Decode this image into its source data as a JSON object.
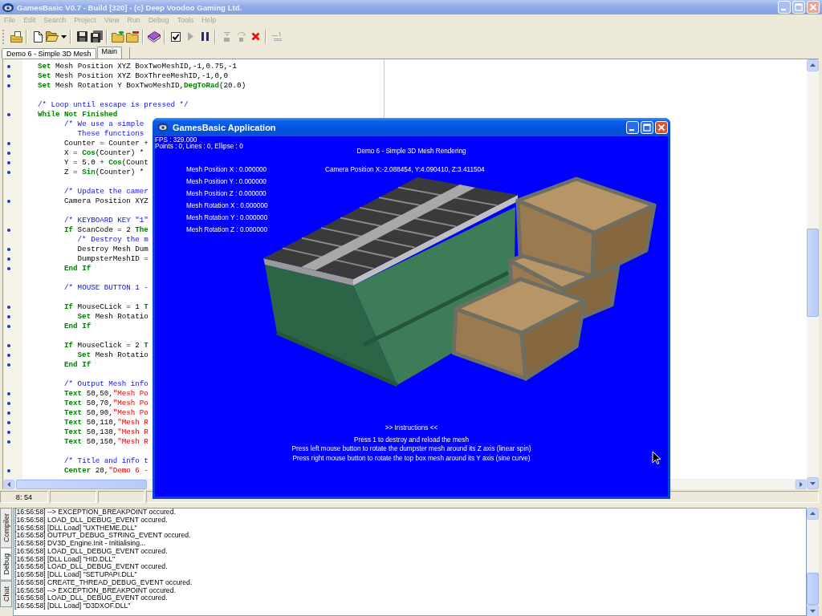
{
  "window": {
    "title": "GamesBasic V0.7 - Build [320] - (c) Deep Voodoo Gaming Ltd.",
    "active": false
  },
  "menu": [
    {
      "label": "File",
      "disabled": true
    },
    {
      "label": "Edit",
      "disabled": true
    },
    {
      "label": "Search",
      "disabled": true
    },
    {
      "label": "Project",
      "disabled": true
    },
    {
      "label": "View",
      "disabled": true
    },
    {
      "label": "Run",
      "disabled": true
    },
    {
      "label": "Debug",
      "disabled": true
    },
    {
      "label": "Tools",
      "disabled": true
    },
    {
      "label": "Help",
      "disabled": true
    }
  ],
  "toolbar": [
    {
      "buttons": [
        {
          "kind": "project",
          "disabled": false
        }
      ]
    },
    {
      "buttons": [
        {
          "kind": "newfile",
          "disabled": false
        },
        {
          "kind": "open",
          "disabled": false
        },
        {
          "kind": "dropdown",
          "disabled": false
        }
      ]
    },
    {
      "buttons": [
        {
          "kind": "save",
          "disabled": false
        },
        {
          "kind": "saveall",
          "disabled": false
        }
      ]
    },
    {
      "buttons": [
        {
          "kind": "addfile",
          "disabled": false
        },
        {
          "kind": "removefile",
          "disabled": false
        }
      ]
    },
    {
      "buttons": [
        {
          "kind": "help",
          "disabled": false
        }
      ]
    },
    {
      "buttons": [
        {
          "kind": "check",
          "disabled": false
        },
        {
          "kind": "run",
          "disabled": true
        },
        {
          "kind": "pause",
          "disabled": false
        }
      ]
    },
    {
      "buttons": [
        {
          "kind": "stepin",
          "disabled": true
        },
        {
          "kind": "stepover",
          "disabled": true
        },
        {
          "kind": "stop",
          "disabled": false
        }
      ]
    },
    {
      "buttons": [
        {
          "kind": "watch",
          "disabled": true
        }
      ]
    }
  ],
  "tabs": [
    {
      "label": "Demo 6 - Simple 3D Mesh",
      "selected": false
    },
    {
      "label": "Main",
      "selected": true
    }
  ],
  "editor": {
    "lines": [
      {
        "marker": true,
        "segments": [
          {
            "kind": "keyword",
            "text": "Set"
          },
          {
            "kind": "plain",
            "text": " Mesh Position XYZ BoxTwoMeshID,-1,0.75,-1"
          }
        ]
      },
      {
        "marker": true,
        "segments": [
          {
            "kind": "keyword",
            "text": "Set"
          },
          {
            "kind": "plain",
            "text": " Mesh Position XYZ BoxThreeMeshID,-1,0,0"
          }
        ]
      },
      {
        "marker": true,
        "segments": [
          {
            "kind": "keyword",
            "text": "Set"
          },
          {
            "kind": "plain",
            "text": " Mesh Rotation Y BoxTwoMeshID,"
          },
          {
            "kind": "keyword",
            "text": "DegToRad"
          },
          {
            "kind": "plain",
            "text": "(20.0)"
          }
        ]
      },
      {
        "marker": false
      },
      {
        "marker": false,
        "segments": [
          {
            "kind": "comment",
            "text": "/* Loop until escape is pressed */"
          }
        ]
      },
      {
        "marker": true,
        "segments": [
          {
            "kind": "keyword",
            "text": "While Not Finished"
          }
        ],
        "children": [
          {
            "marker": false,
            "segments": [
              {
                "kind": "comment",
                "text": "/* We use a simple"
              }
            ],
            "children": [
              {
                "marker": false,
                "segments": [
                  {
                    "kind": "comment",
                    "text": "These functions"
                  }
                ]
              }
            ]
          },
          {
            "marker": true,
            "segments": [
              {
                "kind": "plain",
                "text": "Counter = Counter +"
              }
            ]
          },
          {
            "marker": true,
            "segments": [
              {
                "kind": "plain",
                "text": "X = "
              },
              {
                "kind": "keyword",
                "text": "Cos"
              },
              {
                "kind": "plain",
                "text": "(Counter) *"
              }
            ]
          },
          {
            "marker": true,
            "segments": [
              {
                "kind": "plain",
                "text": "Y = 5.0 + "
              },
              {
                "kind": "keyword",
                "text": "Cos"
              },
              {
                "kind": "plain",
                "text": "(Count"
              }
            ]
          },
          {
            "marker": true,
            "segments": [
              {
                "kind": "plain",
                "text": "Z = "
              },
              {
                "kind": "keyword",
                "text": "Sin"
              },
              {
                "kind": "plain",
                "text": "(Counter) *"
              }
            ]
          },
          {
            "marker": false
          },
          {
            "marker": false,
            "segments": [
              {
                "kind": "comment",
                "text": "/* Update the camer"
              }
            ]
          },
          {
            "marker": true,
            "segments": [
              {
                "kind": "plain",
                "text": "Camera Position XYZ"
              }
            ]
          },
          {
            "marker": false
          },
          {
            "marker": false,
            "segments": [
              {
                "kind": "comment",
                "text": "/* KEYBOARD KEY \"1\""
              }
            ]
          },
          {
            "marker": true,
            "segments": [
              {
                "kind": "keyword",
                "text": "If"
              },
              {
                "kind": "plain",
                "text": " ScanCode = 2 "
              },
              {
                "kind": "keyword",
                "text": "The"
              }
            ],
            "children": [
              {
                "marker": false,
                "segments": [
                  {
                    "kind": "comment",
                    "text": "/* Destroy the m"
                  }
                ]
              },
              {
                "marker": true,
                "segments": [
                  {
                    "kind": "plain",
                    "text": "Destroy Mesh Dum"
                  }
                ]
              },
              {
                "marker": true,
                "segments": [
                  {
                    "kind": "plain",
                    "text": "DumpsterMeshID ="
                  }
                ]
              }
            ]
          },
          {
            "marker": true,
            "segments": [
              {
                "kind": "keyword",
                "text": "End If"
              }
            ]
          },
          {
            "marker": false
          },
          {
            "marker": false,
            "segments": [
              {
                "kind": "comment",
                "text": "/* MOUSE BUTTON 1 -"
              }
            ]
          },
          {
            "marker": false
          },
          {
            "marker": true,
            "segments": [
              {
                "kind": "keyword",
                "text": "If"
              },
              {
                "kind": "plain",
                "text": " MouseCLick = 1 "
              },
              {
                "kind": "keyword",
                "text": "T"
              }
            ],
            "children": [
              {
                "marker": true,
                "segments": [
                  {
                    "kind": "keyword",
                    "text": "Set"
                  },
                  {
                    "kind": "plain",
                    "text": " Mesh Rotatio"
                  }
                ]
              }
            ]
          },
          {
            "marker": true,
            "segments": [
              {
                "kind": "keyword",
                "text": "End If"
              }
            ]
          },
          {
            "marker": false
          },
          {
            "marker": true,
            "segments": [
              {
                "kind": "keyword",
                "text": "If"
              },
              {
                "kind": "plain",
                "text": " MouseClick = 2 "
              },
              {
                "kind": "keyword",
                "text": "T"
              }
            ],
            "children": [
              {
                "marker": true,
                "segments": [
                  {
                    "kind": "keyword",
                    "text": "Set"
                  },
                  {
                    "kind": "plain",
                    "text": " Mesh Rotatio"
                  }
                ]
              }
            ]
          },
          {
            "marker": true,
            "segments": [
              {
                "kind": "keyword",
                "text": "End If"
              }
            ]
          },
          {
            "marker": false
          },
          {
            "marker": false,
            "segments": [
              {
                "kind": "comment",
                "text": "/* Output Mesh info"
              }
            ]
          },
          {
            "marker": true,
            "segments": [
              {
                "kind": "keyword",
                "text": "Text"
              },
              {
                "kind": "plain",
                "text": " 50,50,"
              },
              {
                "kind": "string",
                "text": "\"Mesh Po"
              }
            ]
          },
          {
            "marker": true,
            "segments": [
              {
                "kind": "keyword",
                "text": "Text"
              },
              {
                "kind": "plain",
                "text": " 50,70,"
              },
              {
                "kind": "string",
                "text": "\"Mesh Po"
              }
            ]
          },
          {
            "marker": true,
            "segments": [
              {
                "kind": "keyword",
                "text": "Text"
              },
              {
                "kind": "plain",
                "text": " 50,90,"
              },
              {
                "kind": "string",
                "text": "\"Mesh Po"
              }
            ]
          },
          {
            "marker": true,
            "segments": [
              {
                "kind": "keyword",
                "text": "Text"
              },
              {
                "kind": "plain",
                "text": " 50,110,"
              },
              {
                "kind": "string",
                "text": "\"Mesh R"
              }
            ]
          },
          {
            "marker": true,
            "segments": [
              {
                "kind": "keyword",
                "text": "Text"
              },
              {
                "kind": "plain",
                "text": " 50,130,"
              },
              {
                "kind": "string",
                "text": "\"Mesh R"
              }
            ]
          },
          {
            "marker": true,
            "segments": [
              {
                "kind": "keyword",
                "text": "Text"
              },
              {
                "kind": "plain",
                "text": " 50,150,"
              },
              {
                "kind": "string",
                "text": "\"Mesh R"
              }
            ]
          },
          {
            "marker": false
          },
          {
            "marker": false,
            "segments": [
              {
                "kind": "comment",
                "text": "/* Title and info t"
              }
            ]
          },
          {
            "marker": true,
            "segments": [
              {
                "kind": "keyword",
                "text": "Center"
              },
              {
                "kind": "plain",
                "text": " 20,"
              },
              {
                "kind": "string",
                "text": "\"Demo 6 -"
              }
            ]
          }
        ]
      }
    ]
  },
  "status_bar": {
    "position": "8: 54"
  },
  "output": {
    "tabs": [
      {
        "label": "Compiler",
        "selected": false
      },
      {
        "label": "Debug",
        "selected": true
      },
      {
        "label": "Chat",
        "selected": false
      }
    ],
    "lines": [
      "[16:56:58] --> EXCEPTION_BREAKPOINT occured.",
      "[16:56:58] LOAD_DLL_DEBUG_EVENT occured.",
      "[16:56:58] [DLL Load] \"UXTHEME.DLL\"",
      "[16:56:58] OUTPUT_DEBUG_STRING_EVENT occured.",
      "[16:56:58] DV3D_Engine.Init - Initialising...",
      "[16:56:58] LOAD_DLL_DEBUG_EVENT occured.",
      "[16:56:58] [DLL Load] \"HID.DLL\"",
      "[16:56:58] LOAD_DLL_DEBUG_EVENT occured.",
      "[16:56:58] [DLL Load] \"SETUPAPI.DLL\"",
      "[16:56:58] CREATE_THREAD_DEBUG_EVENT occured.",
      "[16:56:58] --> EXCEPTION_BREAKPOINT occured.",
      "[16:56:58] LOAD_DLL_DEBUG_EVENT occured.",
      "[16:56:58] [DLL Load] \"D3DXOF.DLL\""
    ]
  },
  "app_window": {
    "title": "GamesBasic Application",
    "active": true,
    "fps": "FPS : 329.000",
    "stats": "Points : 0, Lines : 0, Ellipse : 0",
    "heading": "Demo 6 - Simple 3D Mesh Rendering",
    "camera": "Camera Position X:-2.088454, Y:4.090410, Z:3.411504",
    "mesh_info": [
      "Mesh Position X : 0.000000",
      "Mesh Position Y : 0.000000",
      "Mesh Position Z : 0.000000",
      "Mesh Rotation X : 0.000000",
      "Mesh Rotation Y : 0.000000",
      "Mesh Rotation Z : 0.000000"
    ],
    "instructions_title": ">> Instructions <<",
    "instructions": [
      "Press 1 to destroy and reload the mesh",
      "Press left mouse button to rotate the dumpster mesh around its Z axis (linear spin)",
      "Press right mouse button to rotate the top box mesh around its Y axis (sine curve)"
    ]
  }
}
